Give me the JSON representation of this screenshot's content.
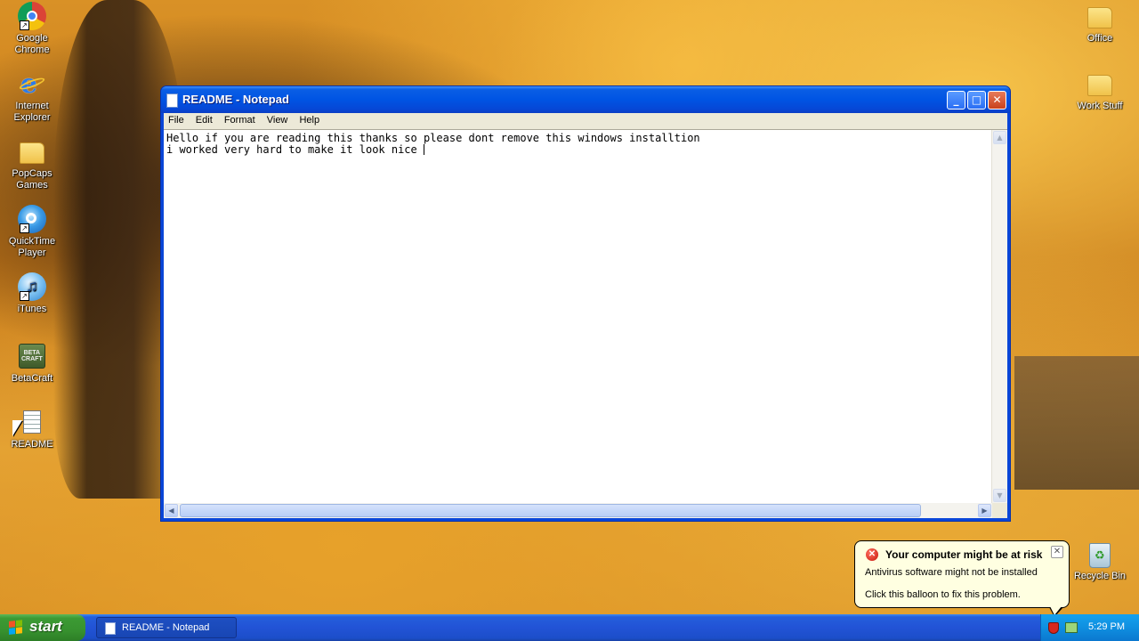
{
  "desktop": {
    "icons_left": [
      {
        "label": "Google Chrome",
        "icon": "chrome-icon"
      },
      {
        "label": "Internet Explorer",
        "icon": "internet-explorer-icon"
      },
      {
        "label": "PopCaps Games",
        "icon": "folder-icon"
      },
      {
        "label": "QuickTime Player",
        "icon": "quicktime-icon"
      },
      {
        "label": "iTunes",
        "icon": "itunes-icon"
      },
      {
        "label": "BetaCraft",
        "icon": "betacraft-icon"
      },
      {
        "label": "README",
        "icon": "text-document-icon"
      }
    ],
    "icons_right": [
      {
        "label": "Office",
        "icon": "folder-icon"
      },
      {
        "label": "Work Stuff",
        "icon": "folder-icon"
      },
      {
        "label": "Recycle Bin",
        "icon": "recycle-bin-icon"
      }
    ]
  },
  "notepad": {
    "title": "README - Notepad",
    "menu": [
      "File",
      "Edit",
      "Format",
      "View",
      "Help"
    ],
    "content_lines": [
      "Hello if you are reading this thanks so please dont remove this windows installtion",
      "i worked very hard to make it look nice "
    ]
  },
  "balloon": {
    "title": "Your computer might be at risk",
    "line1": "Antivirus software might not be installed",
    "line2": "Click this balloon to fix this problem."
  },
  "taskbar": {
    "start_label": "start",
    "active_task": "README - Notepad",
    "clock": "5:29 PM"
  },
  "colors": {
    "titlebar_blue": "#0054e3",
    "start_green": "#3c9a34",
    "tray_blue": "#0f8fe0",
    "balloon_bg": "#ffffe1"
  }
}
